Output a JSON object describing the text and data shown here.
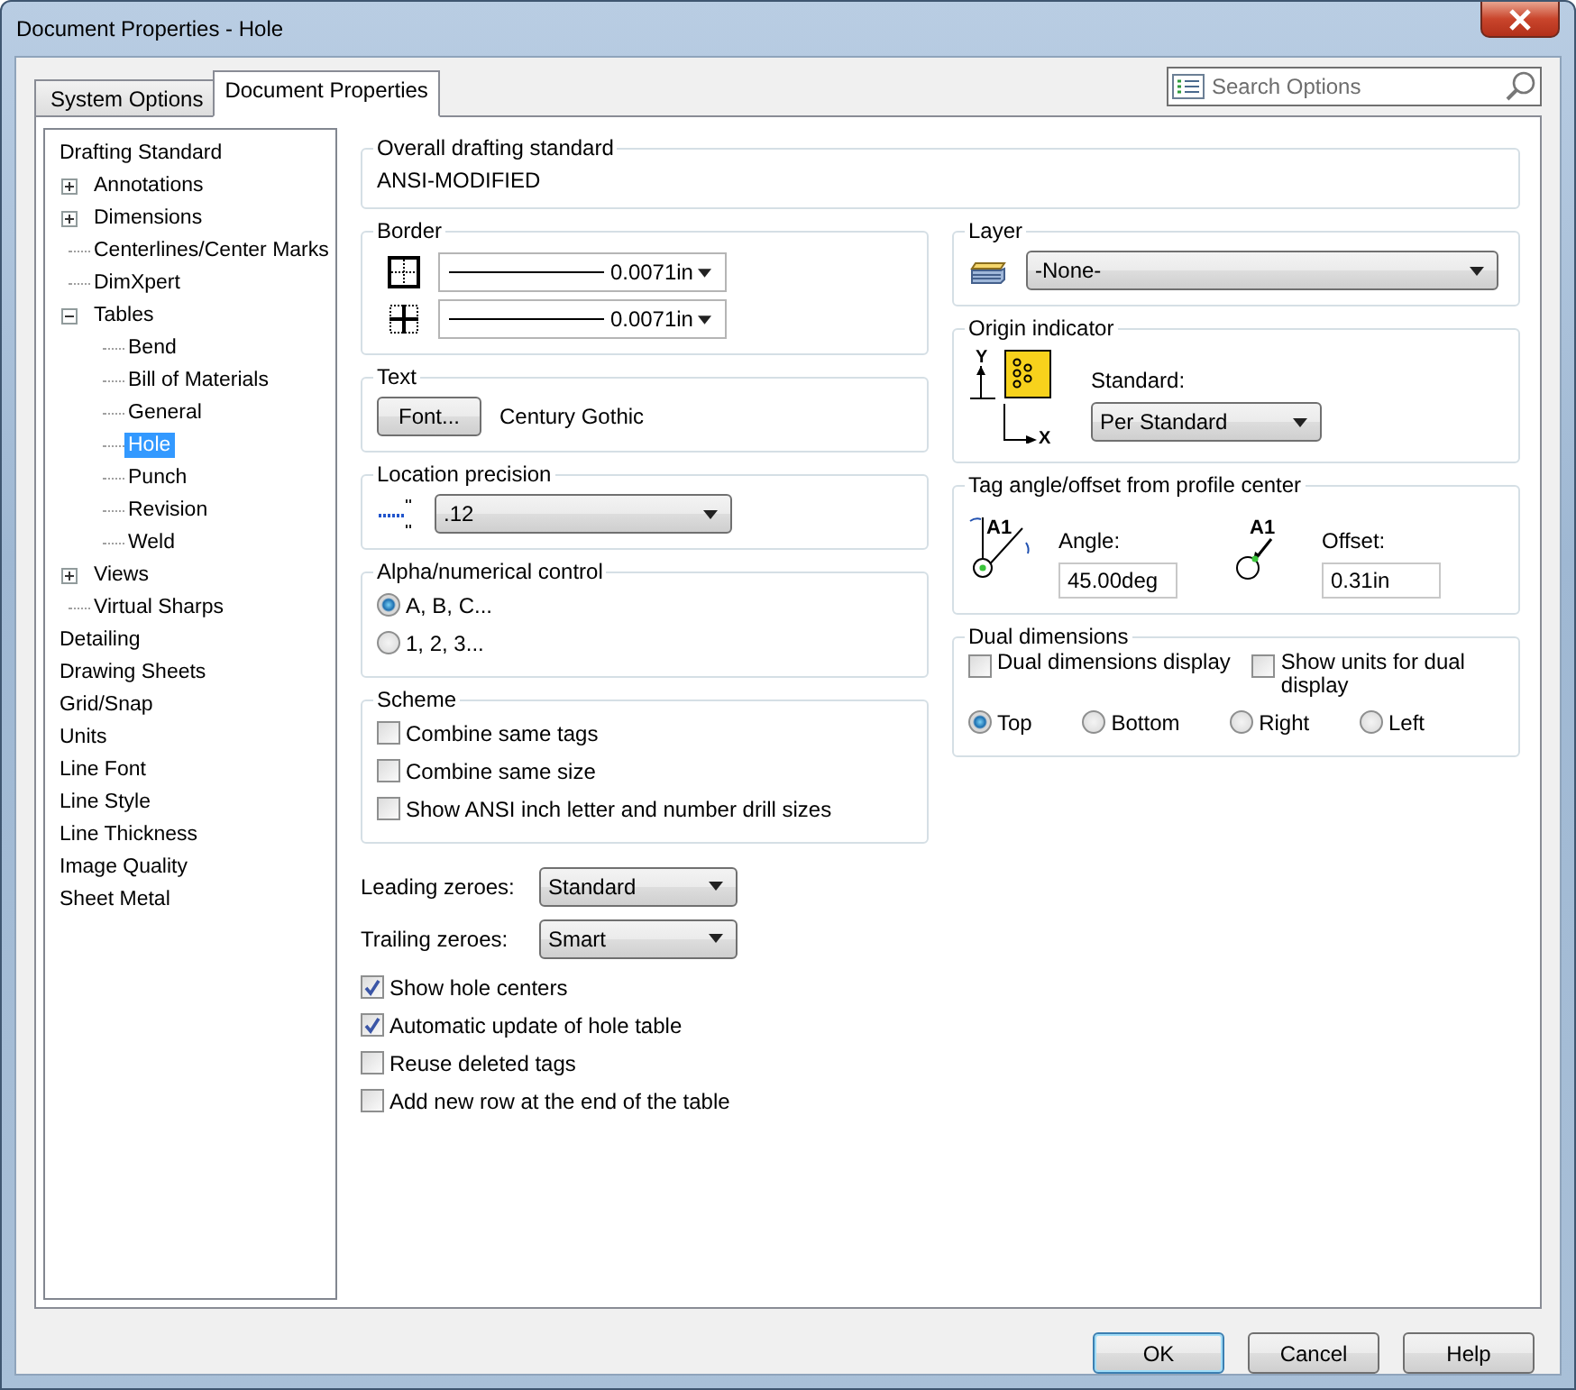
{
  "window": {
    "title": "Document Properties - Hole"
  },
  "tabs": [
    {
      "label": "System Options",
      "selected": false
    },
    {
      "label": "Document Properties",
      "selected": true
    }
  ],
  "search": {
    "placeholder": "Search Options"
  },
  "tree": [
    {
      "label": "Drafting Standard",
      "selected": false,
      "children": [
        {
          "label": "Annotations",
          "selected": false,
          "expanded": false
        },
        {
          "label": "Dimensions",
          "selected": false,
          "expanded": false
        },
        {
          "label": "Centerlines/Center Marks",
          "selected": false
        },
        {
          "label": "DimXpert",
          "selected": false
        },
        {
          "label": "Tables",
          "selected": false,
          "expanded": true,
          "children": [
            {
              "label": "Bend",
              "selected": false
            },
            {
              "label": "Bill of Materials",
              "selected": false
            },
            {
              "label": "General",
              "selected": false
            },
            {
              "label": "Hole",
              "selected": true
            },
            {
              "label": "Punch",
              "selected": false
            },
            {
              "label": "Revision",
              "selected": false
            },
            {
              "label": "Weld",
              "selected": false
            }
          ]
        },
        {
          "label": "Views",
          "selected": false,
          "expanded": false
        },
        {
          "label": "Virtual Sharps",
          "selected": false
        }
      ]
    },
    {
      "label": "Detailing",
      "selected": false
    },
    {
      "label": "Drawing Sheets",
      "selected": false
    },
    {
      "label": "Grid/Snap",
      "selected": false
    },
    {
      "label": "Units",
      "selected": false
    },
    {
      "label": "Line Font",
      "selected": false
    },
    {
      "label": "Line Style",
      "selected": false
    },
    {
      "label": "Line Thickness",
      "selected": false
    },
    {
      "label": "Image Quality",
      "selected": false
    },
    {
      "label": "Sheet Metal",
      "selected": false
    }
  ],
  "overall_drafting_standard": {
    "label": "Overall drafting standard",
    "value": "ANSI-MODIFIED"
  },
  "border": {
    "label": "Border",
    "rows": [
      {
        "kind": "outer",
        "value": "0.0071in"
      },
      {
        "kind": "inner",
        "value": "0.0071in"
      }
    ]
  },
  "text": {
    "label": "Text",
    "button": "Font...",
    "font": "Century Gothic"
  },
  "location_precision": {
    "label": "Location precision",
    "value": ".12"
  },
  "alpha_numerical_control": {
    "label": "Alpha/numerical control",
    "options": [
      {
        "label": "A, B, C...",
        "selected": true
      },
      {
        "label": "1, 2, 3...",
        "selected": false
      }
    ]
  },
  "scheme": {
    "label": "Scheme",
    "options": [
      {
        "label": "Combine same tags",
        "checked": false
      },
      {
        "label": "Combine same size",
        "checked": false
      },
      {
        "label": "Show ANSI inch letter and number drill sizes",
        "checked": false
      }
    ]
  },
  "zeroes": [
    {
      "label": "Leading zeroes:",
      "value": "Standard"
    },
    {
      "label": "Trailing zeroes:",
      "value": "Smart"
    }
  ],
  "options": [
    {
      "label": "Show hole centers",
      "checked": true
    },
    {
      "label": "Automatic update of hole table",
      "checked": true
    },
    {
      "label": "Reuse deleted tags",
      "checked": false
    },
    {
      "label": "Add new row at the end of the table",
      "checked": false
    }
  ],
  "layer": {
    "label": "Layer",
    "value": "-None-"
  },
  "origin_indicator": {
    "label": "Origin indicator",
    "axis_y": "Y",
    "axis_x": "X",
    "standard_label": "Standard:",
    "value": "Per Standard"
  },
  "tag_angle_offset": {
    "label": "Tag angle/offset from profile center",
    "angle_tag": "A1",
    "angle_label": "Angle:",
    "angle": "45.00deg",
    "offset_tag": "A1",
    "offset_label": "Offset:",
    "offset": "0.31in"
  },
  "dual_dimensions": {
    "label": "Dual dimensions",
    "checks": [
      {
        "label": "Dual dimensions display",
        "checked": false
      },
      {
        "label": "Show units for dual display",
        "checked": false
      }
    ],
    "positions": [
      {
        "label": "Top",
        "selected": true
      },
      {
        "label": "Bottom",
        "selected": false
      },
      {
        "label": "Right",
        "selected": false
      },
      {
        "label": "Left",
        "selected": false
      }
    ]
  },
  "buttons": [
    {
      "label": "OK",
      "default": true
    },
    {
      "label": "Cancel",
      "default": false
    },
    {
      "label": "Help",
      "default": false
    }
  ]
}
